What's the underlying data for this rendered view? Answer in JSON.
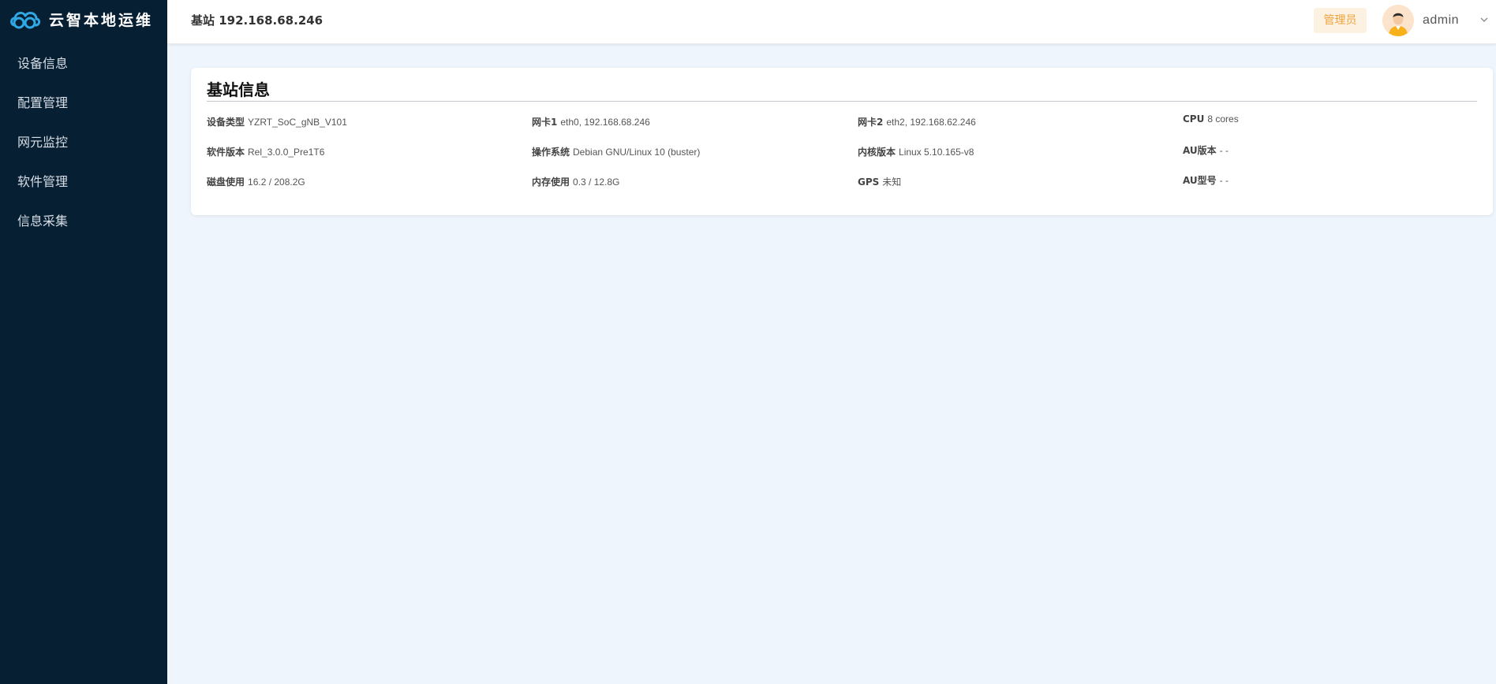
{
  "app": {
    "title": "云智本地运维"
  },
  "sidebar": {
    "items": [
      {
        "label": "设备信息"
      },
      {
        "label": "配置管理"
      },
      {
        "label": "网元监控"
      },
      {
        "label": "软件管理"
      },
      {
        "label": "信息采集"
      }
    ]
  },
  "header": {
    "title": "基站 192.168.68.246",
    "role": "管理员",
    "username": "admin",
    "avatar_icon": "user-avatar-icon",
    "caret_icon": "chevron-down-icon"
  },
  "card": {
    "title": "基站信息",
    "rows": [
      [
        {
          "label": "设备类型",
          "value": "YZRT_SoC_gNB_V101"
        },
        {
          "label": "网卡1",
          "value": "eth0, 192.168.68.246"
        },
        {
          "label": "网卡2",
          "value": "eth2, 192.168.62.246"
        },
        {
          "label": "CPU",
          "value": "8 cores"
        }
      ],
      [
        {
          "label": "软件版本",
          "value": "Rel_3.0.0_Pre1T6"
        },
        {
          "label": "操作系统",
          "value": "Debian GNU/Linux 10 (buster)"
        },
        {
          "label": "内核版本",
          "value": "Linux 5.10.165-v8"
        },
        {
          "label": "AU版本",
          "value": "- -"
        }
      ],
      [
        {
          "label": "磁盘使用",
          "value": "16.2 / 208.2G"
        },
        {
          "label": "内存使用",
          "value": "0.3 / 12.8G"
        },
        {
          "label": "GPS",
          "value": "未知"
        },
        {
          "label": "AU型号",
          "value": "- -"
        }
      ]
    ]
  },
  "colors": {
    "sidebar_bg": "#071f33",
    "page_bg": "#eef5fd",
    "badge_bg": "#fdf1e2",
    "badge_text": "#f0a23a"
  }
}
